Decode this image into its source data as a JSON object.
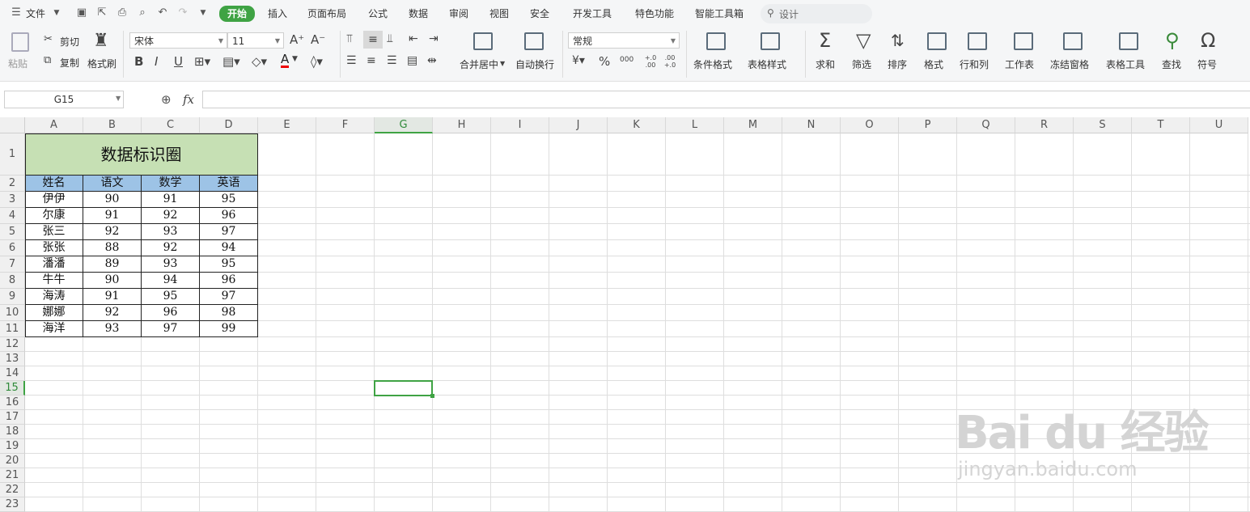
{
  "menu": {
    "file": "文件",
    "tabs": [
      "开始",
      "插入",
      "页面布局",
      "公式",
      "数据",
      "审阅",
      "视图",
      "安全",
      "开发工具",
      "特色功能",
      "智能工具箱"
    ],
    "search_placeholder": "设计"
  },
  "ribbon": {
    "paste": "粘贴",
    "cut": "剪切",
    "copy": "复制",
    "format_painter": "格式刷",
    "font_name": "宋体",
    "font_size": "11",
    "bold": "B",
    "italic": "I",
    "underline": "U",
    "merge_center": "合并居中",
    "wrap_text": "自动换行",
    "number_format": "常规",
    "percent": "%",
    "thousands": "000",
    "inc_decimal": "+.0 .00",
    "dec_decimal": ".00 +.0",
    "conditional_format": "条件格式",
    "table_style": "表格样式",
    "sum": "求和",
    "filter": "筛选",
    "sort": "排序",
    "format": "格式",
    "row_col": "行和列",
    "worksheet": "工作表",
    "freeze": "冻结窗格",
    "table_tools": "表格工具",
    "find": "查找",
    "symbol": "符号"
  },
  "formula_bar": {
    "name_box": "G15",
    "fx": "fx",
    "formula": ""
  },
  "sheet": {
    "columns": [
      "A",
      "B",
      "C",
      "D",
      "E",
      "F",
      "G",
      "H",
      "I",
      "J",
      "K",
      "L",
      "M",
      "N",
      "O",
      "P",
      "Q",
      "R",
      "S",
      "T",
      "U"
    ],
    "rows": [
      "1",
      "2",
      "3",
      "4",
      "5",
      "6",
      "7",
      "8",
      "9",
      "10",
      "11",
      "12",
      "13",
      "14",
      "15",
      "16",
      "17",
      "18",
      "19",
      "20",
      "21",
      "22",
      "23"
    ],
    "selected_cell": "G15",
    "title": "数据标识圈",
    "headers": [
      "姓名",
      "语文",
      "数学",
      "英语"
    ],
    "data": [
      [
        "伊伊",
        "90",
        "91",
        "95"
      ],
      [
        "尔康",
        "91",
        "92",
        "96"
      ],
      [
        "张三",
        "92",
        "93",
        "97"
      ],
      [
        "张张",
        "88",
        "92",
        "94"
      ],
      [
        "潘潘",
        "89",
        "93",
        "95"
      ],
      [
        "牛牛",
        "90",
        "94",
        "96"
      ],
      [
        "海涛",
        "91",
        "95",
        "97"
      ],
      [
        "娜娜",
        "92",
        "96",
        "98"
      ],
      [
        "海洋",
        "93",
        "97",
        "99"
      ]
    ]
  },
  "watermark": {
    "brand": "Bai du 经验",
    "url": "jingyan.baidu.com"
  },
  "colors": {
    "accent": "#3fa344",
    "title_fill": "#c6e0b4",
    "header_fill": "#9dc3e6"
  }
}
